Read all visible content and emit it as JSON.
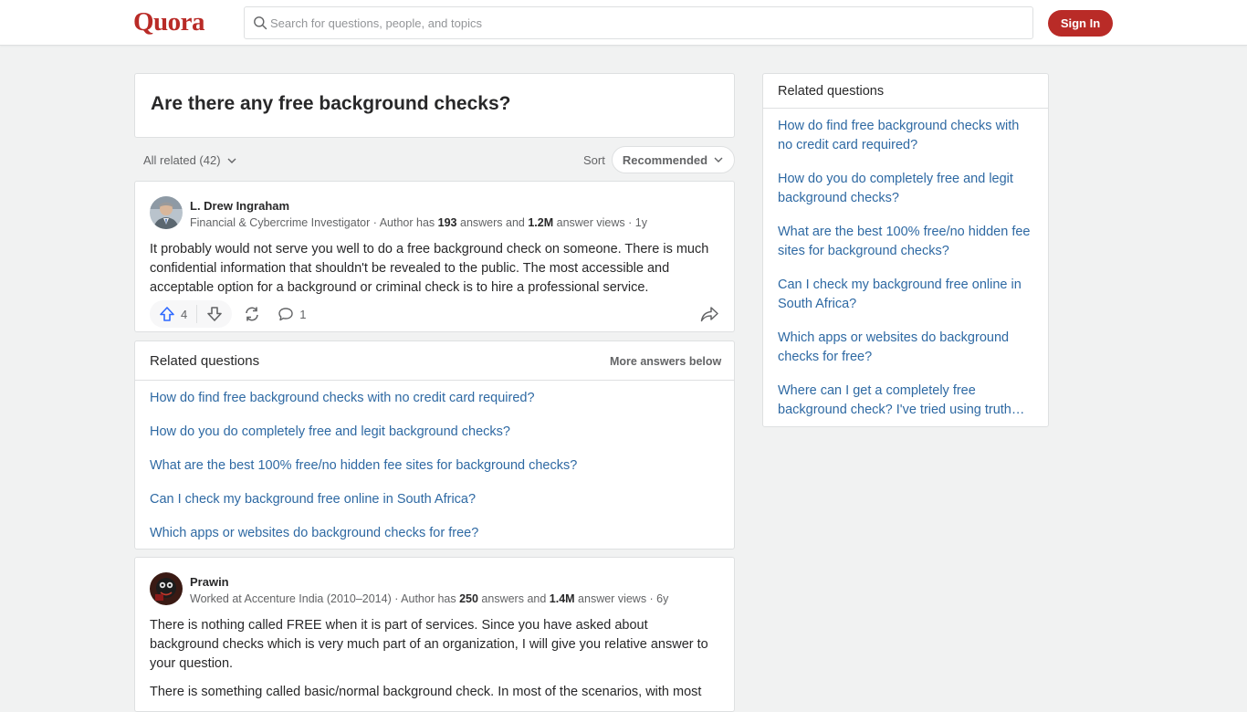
{
  "header": {
    "logo": "Quora",
    "search_placeholder": "Search for questions, people, and topics",
    "signin_label": "Sign In"
  },
  "question": {
    "title": "Are there any free background checks?"
  },
  "filters": {
    "all_related": "All related (42)",
    "sort_label": "Sort",
    "sort_value": "Recommended"
  },
  "answers": [
    {
      "author": "L. Drew Ingraham",
      "cred_prefix": "Financial & Cybercrime Investigator · Author has ",
      "answers_count": "193",
      "cred_mid": " answers and ",
      "views_count": "1.2M",
      "cred_suffix": " answer views · 1y",
      "text": "It probably would not serve you well to do a free background check on someone. There is much confidential information that shouldn't be revealed to the public. The most accessible and acceptable option for a background or criminal check is to hire a professional service.",
      "upvotes": "4",
      "comments": "1"
    },
    {
      "author": "Prawin",
      "cred_prefix": "Worked at Accenture India (2010–2014) · Author has ",
      "answers_count": "250",
      "cred_mid": " answers and ",
      "views_count": "1.4M",
      "cred_suffix": " answer views · 6y",
      "text": "There is nothing called FREE when it is part of services. Since you have asked about background checks which is very much part of an organization, I will give you relative answer to your question.",
      "text2": "There is something called basic/normal background check. In most of the scenarios, with most"
    }
  ],
  "related_inline": {
    "title": "Related questions",
    "more": "More answers below",
    "items": [
      "How do find free background checks with no credit card required?",
      "How do you do completely free and legit background checks?",
      "What are the best 100% free/no hidden fee sites for background checks?",
      "Can I check my background free online in South Africa?",
      "Which apps or websites do background checks for free?"
    ]
  },
  "related_sidebar": {
    "title": "Related questions",
    "items": [
      "How do find free background checks with no credit card required?",
      "How do you do completely free and legit background checks?",
      "What are the best 100% free/no hidden fee sites for background checks?",
      "Can I check my background free online in South Africa?",
      "Which apps or websites do background checks for free?",
      "Where can I get a completely free background check? I've tried using truth…"
    ]
  },
  "colors": {
    "brand": "#b92b27",
    "link": "#2e69a3",
    "upvote": "#2e69ff"
  }
}
